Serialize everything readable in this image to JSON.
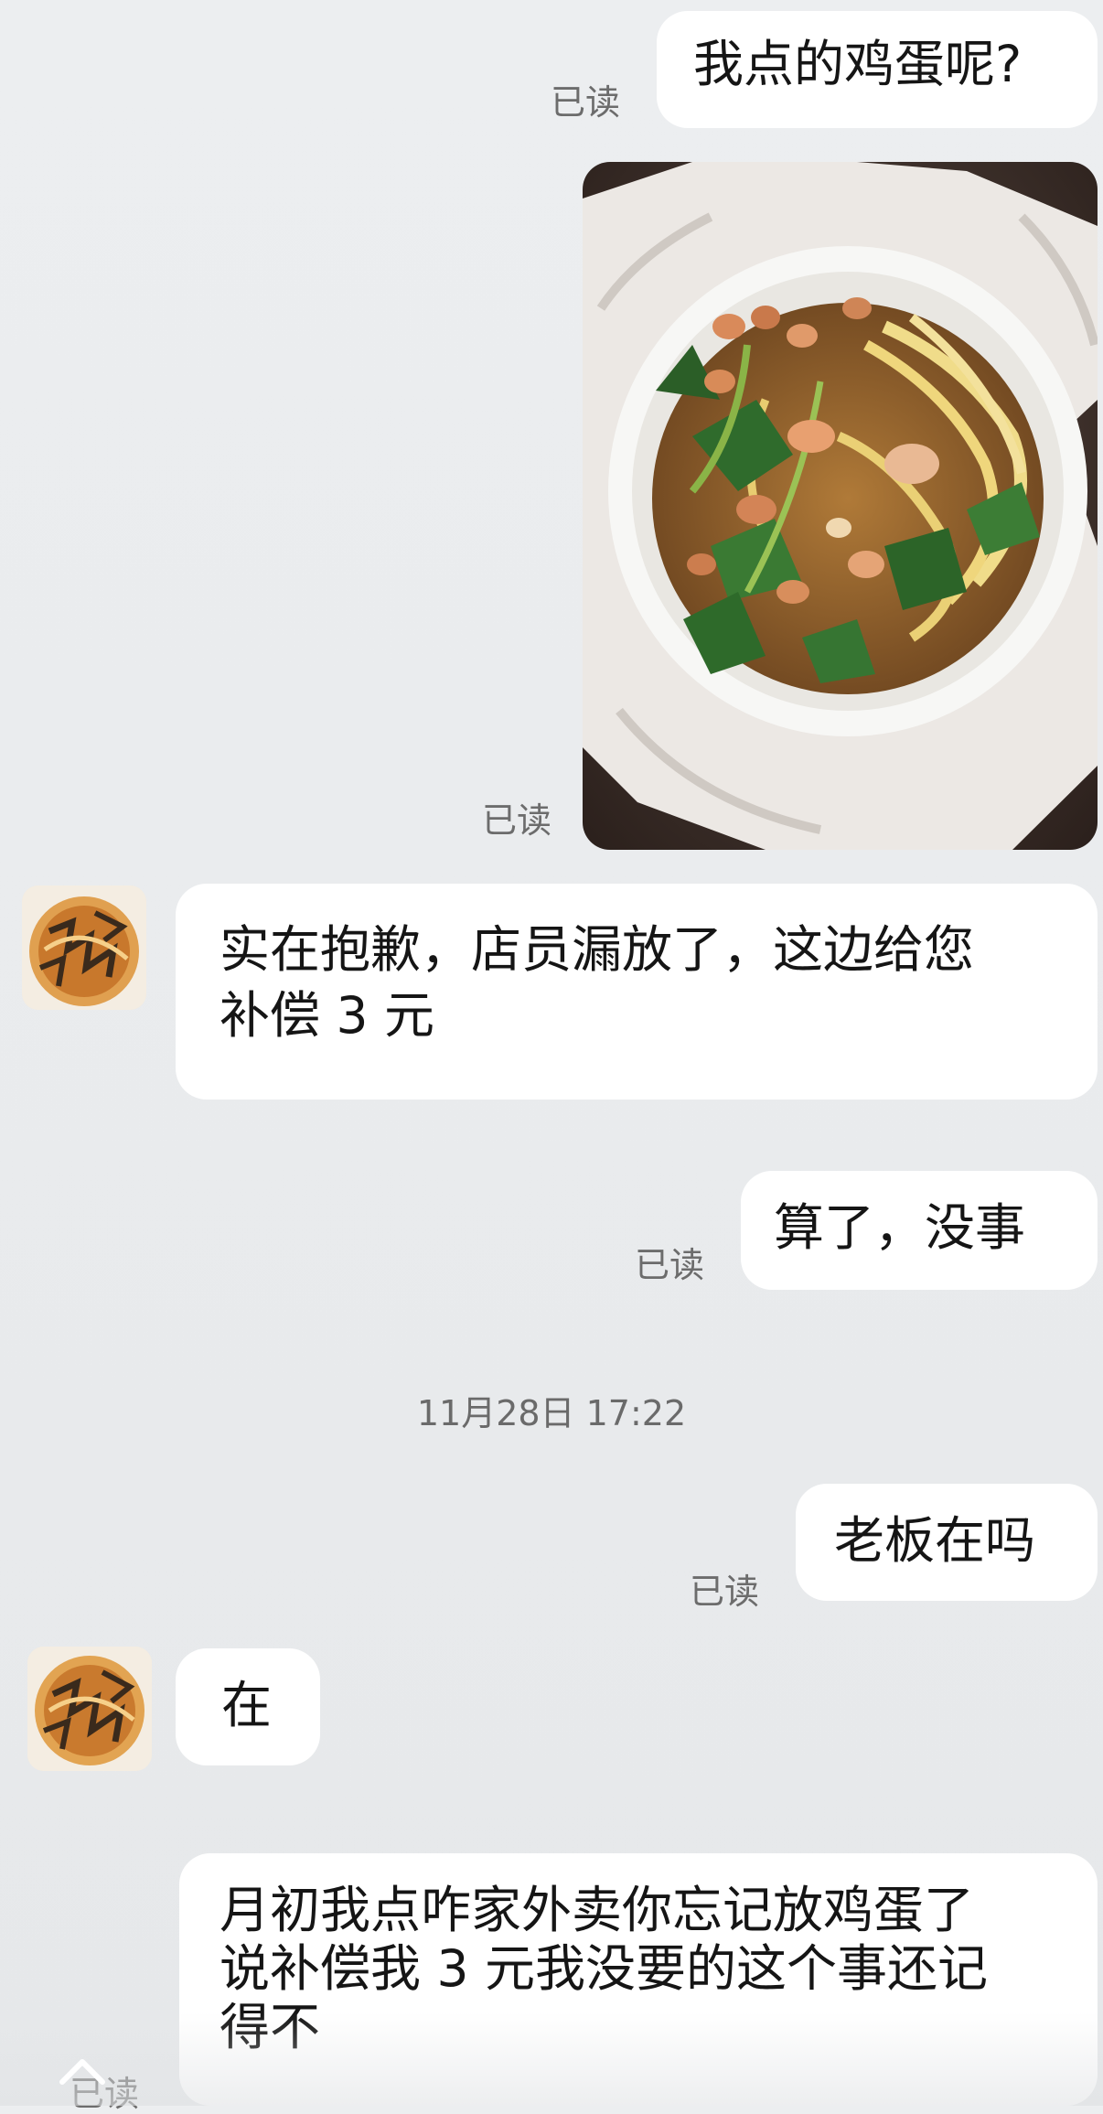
{
  "messages": {
    "m1": {
      "text": "我点的鸡蛋呢?",
      "status": "已读"
    },
    "m2": {
      "status": "已读"
    },
    "m3": {
      "text": "实在抱歉，店员漏放了，这边给您\n补偿 3 元"
    },
    "m4": {
      "text": "算了，没事",
      "status": "已读"
    },
    "timestamp": "11月28日 17:22",
    "m5": {
      "text": "老板在吗",
      "status": "已读"
    },
    "m6": {
      "text": "在"
    },
    "m7": {
      "text": "月初我点咋家外卖你忘记放鸡蛋了\n说补偿我 3 元我没要的这个事还记\n得不",
      "status": "已读"
    }
  },
  "icons": {
    "merchant_avatar": "shop-logo-avatar",
    "food_photo": "noodle-bowl-photo",
    "scroll_up": "chevron-up-icon"
  },
  "colors": {
    "background": "#eceef0",
    "bubble": "#ffffff",
    "read_receipt": "#6c6c6c"
  }
}
